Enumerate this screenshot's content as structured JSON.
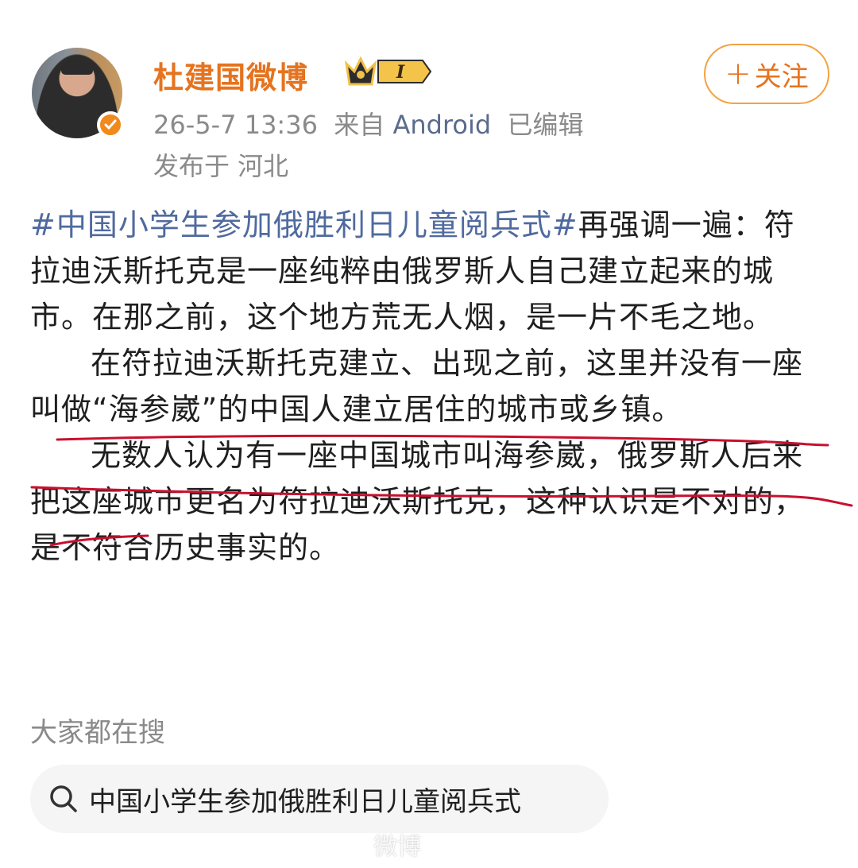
{
  "post": {
    "username": "杜建国微博",
    "vip_level": "I",
    "timestamp": "26-5-7 13:36",
    "source_prefix": "来自",
    "source": "Android",
    "edited": "已编辑",
    "location": "发布于 河北",
    "follow_label": "关注",
    "hashtag": "#中国小学生参加俄胜利日儿童阅兵式#",
    "paragraph1_rest": "再强调一遍：符拉迪沃斯托克是一座纯粹由俄罗斯人自己建立起来的城市。在那之前，这个地方荒无人烟，是一片不毛之地。",
    "paragraph2": "在符拉迪沃斯托克建立、出现之前，这里并没有一座叫做“海参崴”的中国人建立居住的城市或乡镇。",
    "paragraph3": "无数人认为有一座中国城市叫海参崴，俄罗斯人后来把这座城市更名为符拉迪沃斯托克，这种认识是不对的，是不符合历史事实的。"
  },
  "search": {
    "title": "大家都在搜",
    "query": "中国小学生参加俄胜利日儿童阅兵式"
  },
  "watermark": "微博",
  "colors": {
    "username": "#e5731f",
    "hashtag": "#506a9f",
    "annotation": "#c8102e",
    "verified": "#f08a1c"
  }
}
